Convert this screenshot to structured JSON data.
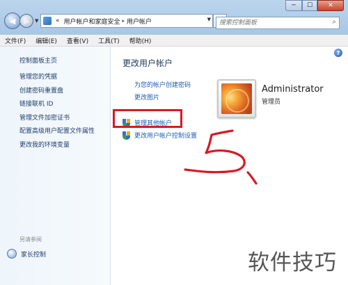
{
  "window": {
    "controls": {
      "minimize": "─",
      "maximize": "☐",
      "close": "✕"
    },
    "nav": {
      "back_icon": "arrow-left-icon",
      "forward_icon": "arrow-right-icon"
    },
    "address": {
      "prefix": "«",
      "breadcrumbs": [
        "用户帐户和家庭安全",
        "用户帐户"
      ],
      "separator": "▸",
      "refresh_glyph": "↻"
    },
    "search": {
      "placeholder": "搜索控制面板"
    }
  },
  "menu": [
    "文件(F)",
    "编辑(E)",
    "查看(V)",
    "工具(T)",
    "帮助(H)"
  ],
  "sidebar": {
    "home": "控制面板主页",
    "links": [
      "管理您的凭据",
      "创建密码重置盘",
      "链接联机 ID",
      "管理文件加密证书",
      "配置高级用户配置文件属性",
      "更改我的环境变量"
    ],
    "see_also": "另请参阅",
    "parental": "家长控制"
  },
  "main": {
    "help_glyph": "?",
    "title": "更改用户帐户",
    "links": [
      "为您的帐户创建密码",
      "更改图片"
    ],
    "shield_links": [
      "管理其他帐户",
      "更改用户帐户控制设置"
    ],
    "user": {
      "name": "Administrator",
      "role": "管理员"
    }
  },
  "annotation_text": "5.",
  "watermark": "软件技巧",
  "colors": {
    "link": "#1a5fb4",
    "highlight_box": "#d61a24",
    "annotation": "#d61a24"
  }
}
